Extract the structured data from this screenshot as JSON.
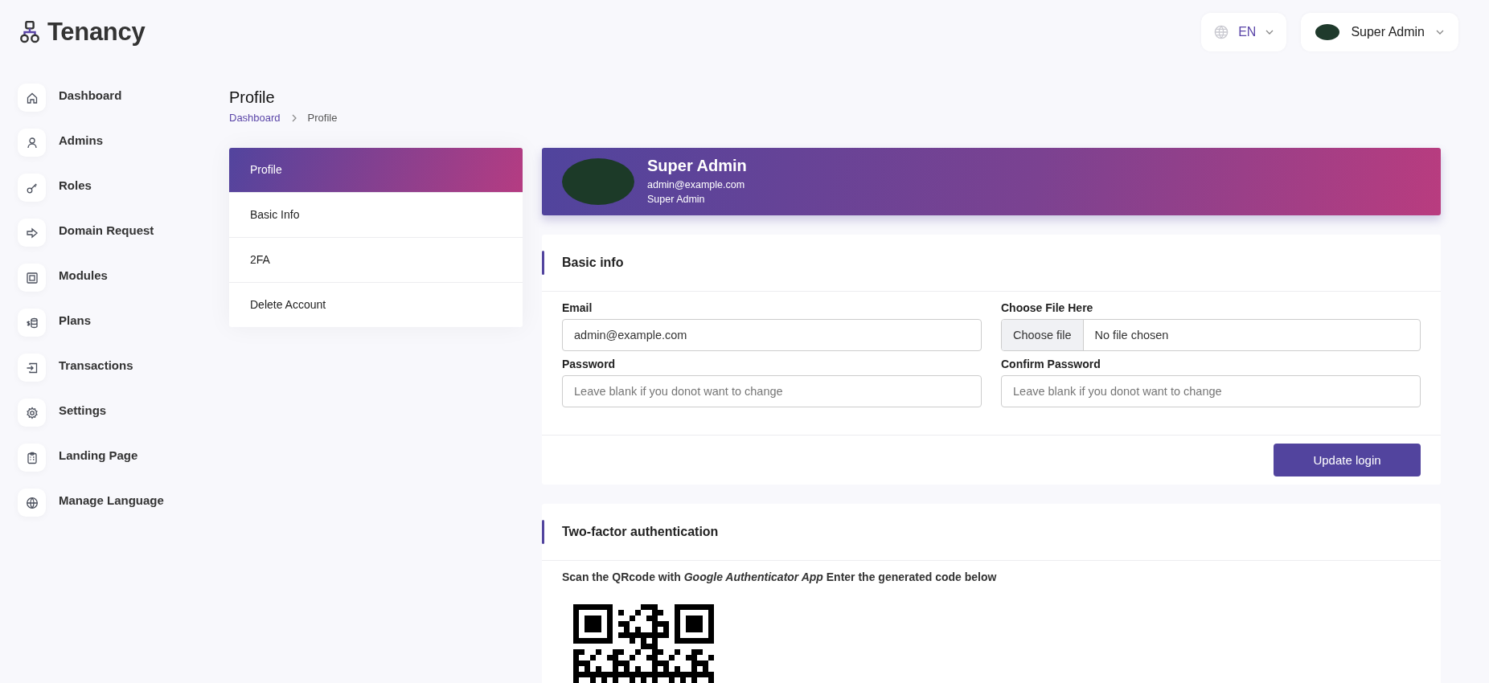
{
  "brand": {
    "name": "Tenancy"
  },
  "header": {
    "language": "EN",
    "user": "Super Admin"
  },
  "sidebar": {
    "items": [
      {
        "label": "Dashboard"
      },
      {
        "label": "Admins"
      },
      {
        "label": "Roles"
      },
      {
        "label": "Domain Request"
      },
      {
        "label": "Modules"
      },
      {
        "label": "Plans"
      },
      {
        "label": "Transactions"
      },
      {
        "label": "Settings"
      },
      {
        "label": "Landing Page"
      },
      {
        "label": "Manage Language"
      }
    ]
  },
  "page": {
    "title": "Profile",
    "breadcrumb": [
      {
        "label": "Dashboard"
      },
      {
        "label": "Profile"
      }
    ]
  },
  "profile_menu": {
    "items": [
      {
        "label": "Profile",
        "selected": true
      },
      {
        "label": "Basic Info",
        "selected": false
      },
      {
        "label": "2FA",
        "selected": false
      },
      {
        "label": "Delete Account",
        "selected": false
      }
    ]
  },
  "profile_card": {
    "name": "Super Admin",
    "email": "admin@example.com",
    "role": "Super Admin"
  },
  "basic_info": {
    "title": "Basic info",
    "fields": [
      {
        "kind": "text",
        "label": "Email",
        "value": "admin@example.com"
      },
      {
        "kind": "file",
        "label": "Choose File Here",
        "button": "Choose file",
        "value": "No file chosen"
      },
      {
        "kind": "password",
        "label": "Password",
        "placeholder": "Leave blank if you donot want to change"
      },
      {
        "kind": "password",
        "label": "Confirm Password",
        "placeholder": "Leave blank if you donot want to change"
      }
    ],
    "button": "Update login"
  },
  "two_factor": {
    "title": "Two-factor authentication",
    "instruction": "Scan the QRcode with *Google Authenticator App* Enter the generated code below"
  }
}
